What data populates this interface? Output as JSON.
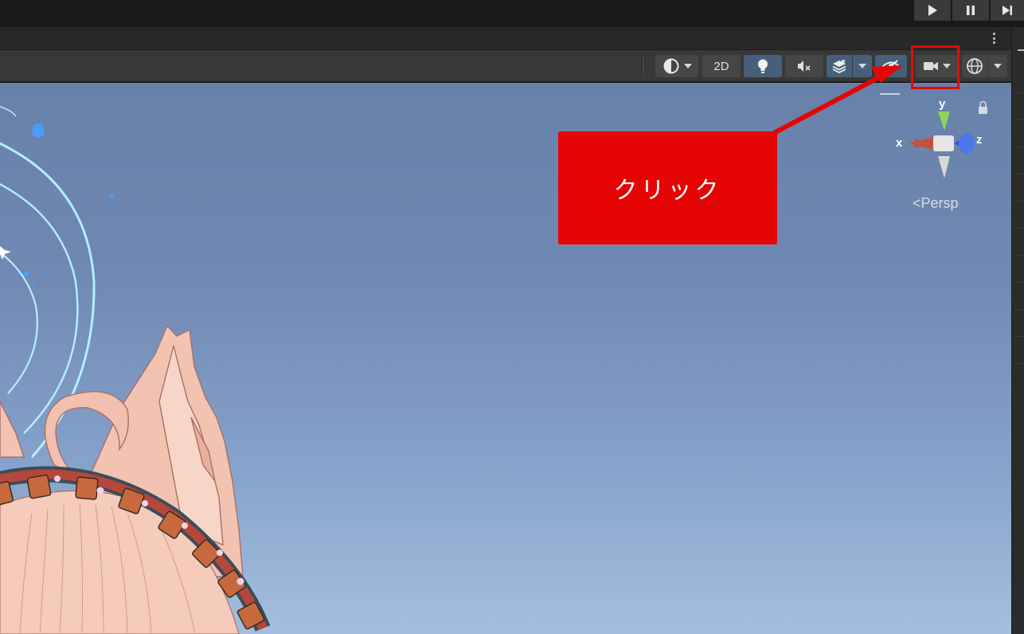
{
  "toolbar": {
    "two_d_label": "2D"
  },
  "gizmo": {
    "axis_y": "y",
    "axis_x": "x",
    "axis_z": "z",
    "projection": "Persp"
  },
  "callout": {
    "text": "クリック"
  },
  "colors": {
    "accent_blue": "#46607c",
    "callout_red": "#e60505",
    "toolbar_bg": "#383838"
  },
  "icons": {
    "play": "play-icon",
    "pause": "pause-icon",
    "step": "step-icon",
    "draw_mode": "shading-mode-icon",
    "lighting": "light-bulb-icon",
    "audio": "audio-mute-icon",
    "effects": "effects-layers-icon",
    "visibility": "scene-visibility-icon",
    "camera": "camera-icon",
    "gizmos": "gizmos-icon",
    "lock": "lock-icon"
  }
}
